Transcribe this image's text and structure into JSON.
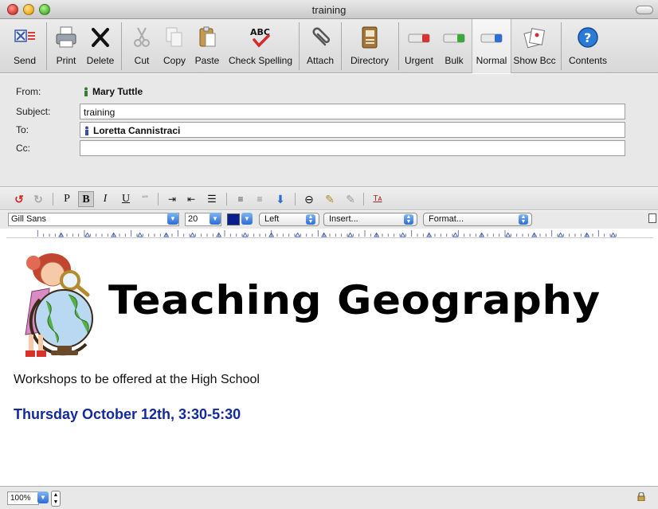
{
  "window": {
    "title": "training"
  },
  "toolbar": {
    "items": [
      {
        "label": "Send",
        "icon": "send-icon"
      },
      {
        "label": "Print",
        "icon": "printer-icon"
      },
      {
        "label": "Delete",
        "icon": "delete-x-icon"
      },
      {
        "label": "Cut",
        "icon": "scissors-icon"
      },
      {
        "label": "Copy",
        "icon": "copy-icon"
      },
      {
        "label": "Paste",
        "icon": "clipboard-icon"
      },
      {
        "label": "Check Spelling",
        "icon": "abc-check-icon"
      },
      {
        "label": "Attach",
        "icon": "paperclip-icon"
      },
      {
        "label": "Directory",
        "icon": "address-book-icon"
      },
      {
        "label": "Urgent",
        "icon": "priority-red-icon"
      },
      {
        "label": "Bulk",
        "icon": "priority-green-icon"
      },
      {
        "label": "Normal",
        "icon": "priority-blue-icon"
      },
      {
        "label": "Show Bcc",
        "icon": "cards-icon"
      },
      {
        "label": "Contents",
        "icon": "help-icon"
      }
    ],
    "selected": "Normal"
  },
  "headers": {
    "from_label": "From:",
    "from_value": "Mary Tuttle",
    "subject_label": "Subject:",
    "subject_value": "training",
    "to_label": "To:",
    "to_value": "Loretta Cannistraci",
    "cc_label": "Cc:",
    "cc_value": ""
  },
  "format_toolbar": {
    "plain": "P",
    "bold": "B",
    "italic": "I",
    "underline": "U",
    "quote": "“”"
  },
  "fontbar": {
    "font": "Gill Sans",
    "size": "20",
    "color": "#0a1f8f",
    "alignment": "Left",
    "insert": "Insert...",
    "format": "Format..."
  },
  "body": {
    "heading": "Teaching Geography",
    "line1": "Workshops to be offered at the High School",
    "line2": "Thursday October 12th, 3:30-5:30"
  },
  "status": {
    "zoom": "100%"
  },
  "colors": {
    "accent": "#2c6dd6",
    "body_blue": "#14299b"
  }
}
